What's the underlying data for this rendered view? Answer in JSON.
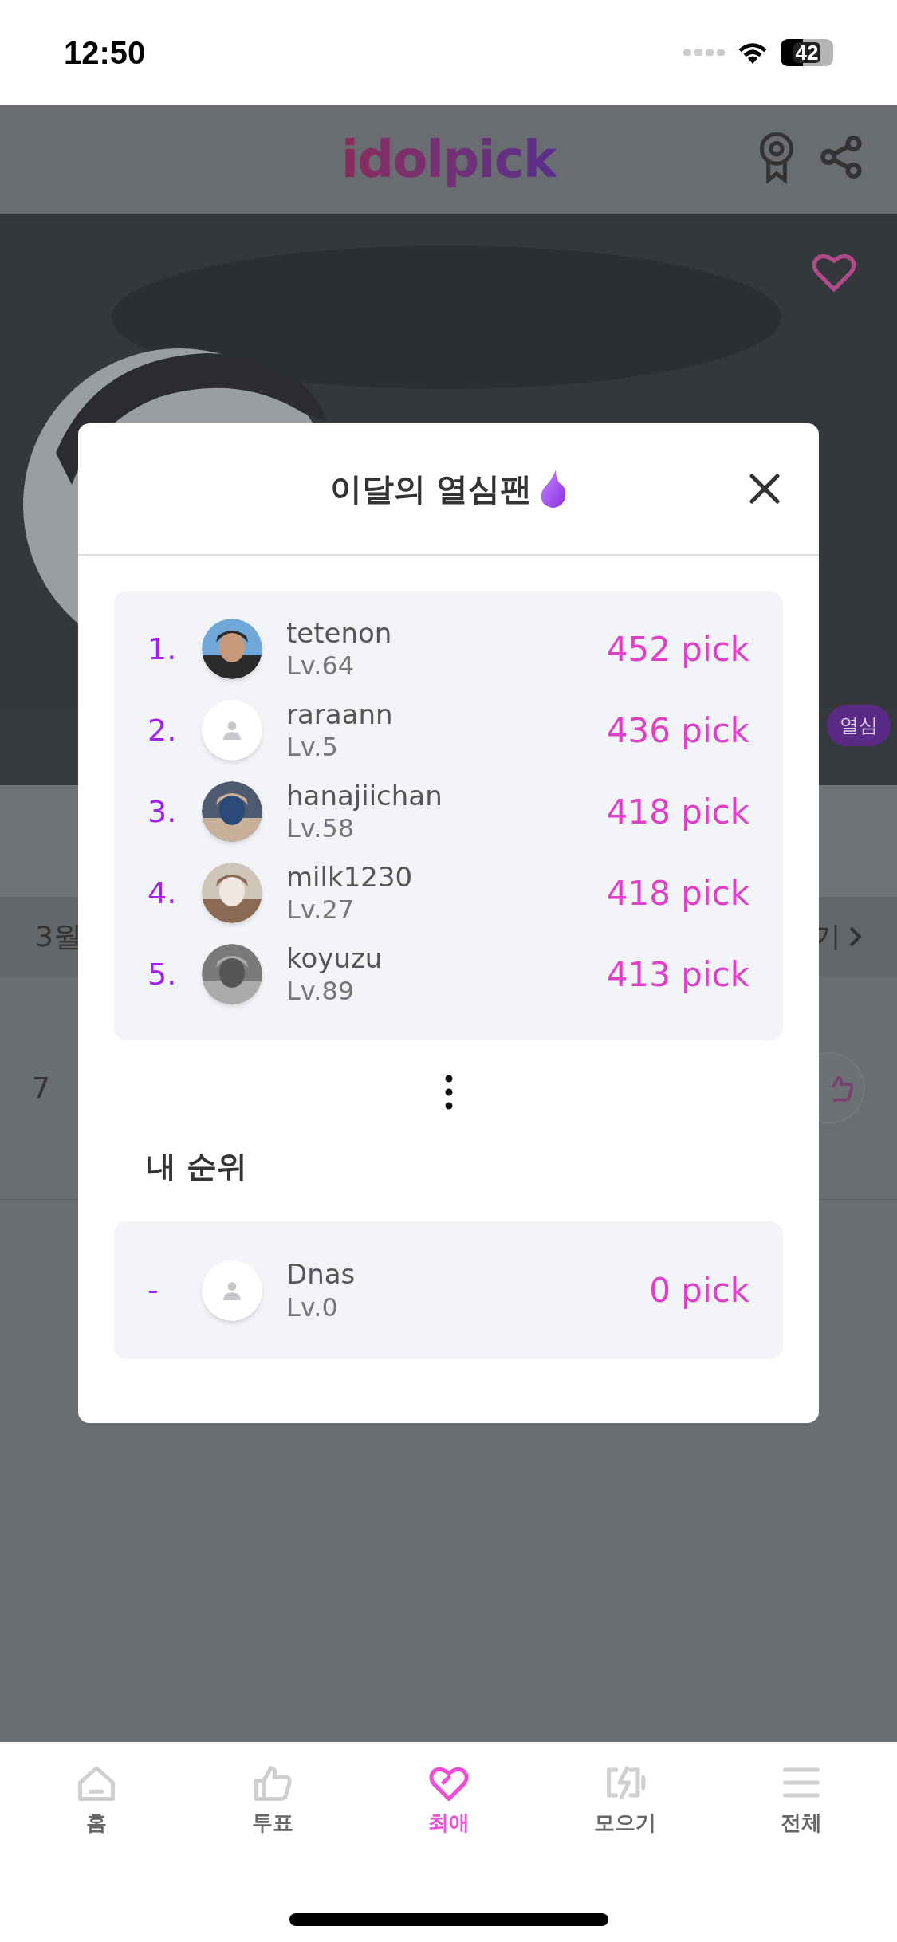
{
  "status_bar": {
    "time": "12:50",
    "battery": "42"
  },
  "header": {
    "logo": "idolpick"
  },
  "background": {
    "badge": "열심",
    "month_label": "3월",
    "link": "기",
    "rank": "7"
  },
  "modal": {
    "title": "이달의 열심팬",
    "ranking": [
      {
        "rank": "1.",
        "name": "tetenon",
        "level": "Lv.64",
        "points": "452 pick"
      },
      {
        "rank": "2.",
        "kind": "default",
        "name": "raraann",
        "level": "Lv.5",
        "points": "436 pick"
      },
      {
        "rank": "3.",
        "name": "hanajiichan",
        "level": "Lv.58",
        "points": "418 pick"
      },
      {
        "rank": "4.",
        "name": "milk1230",
        "level": "Lv.27",
        "points": "418 pick"
      },
      {
        "rank": "5.",
        "name": "koyuzu",
        "level": "Lv.89",
        "points": "413 pick"
      }
    ],
    "my_rank": {
      "heading": "내 순위",
      "rank": "-",
      "kind": "default",
      "name": "Dnas",
      "level": "Lv.0",
      "points": "0 pick"
    }
  },
  "tab_bar": [
    {
      "label": "홈",
      "kind": "home",
      "selected": false
    },
    {
      "label": "투표",
      "kind": "vote",
      "selected": false
    },
    {
      "label": "최애",
      "kind": "favorite",
      "selected": true
    },
    {
      "label": "모으기",
      "kind": "collect",
      "selected": false
    },
    {
      "label": "전체",
      "kind": "all",
      "selected": false
    }
  ]
}
